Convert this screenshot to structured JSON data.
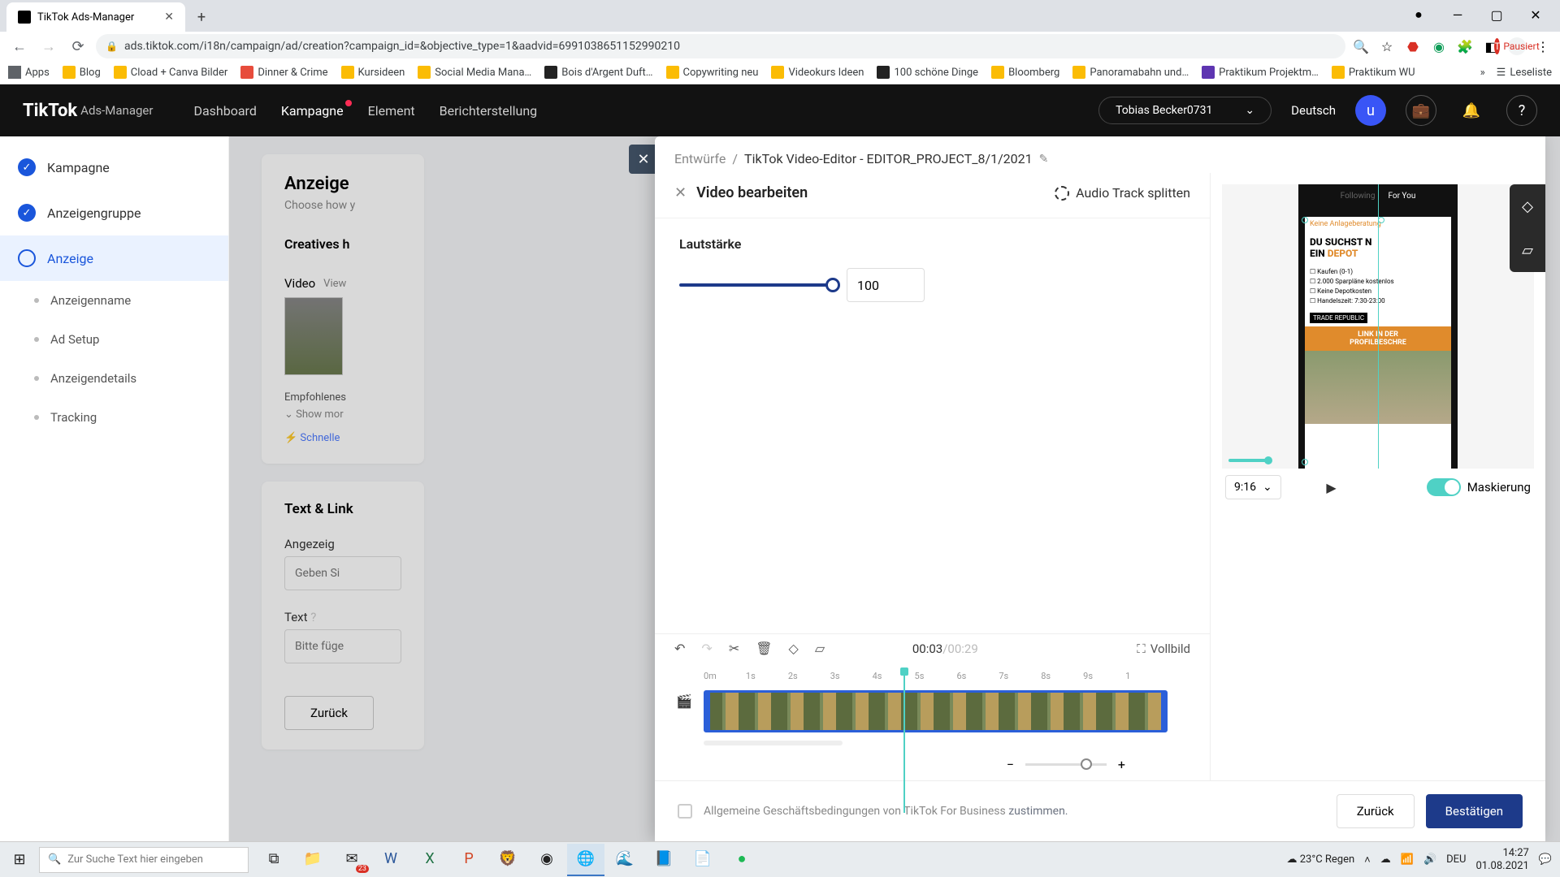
{
  "browser": {
    "tab_title": "TikTok Ads-Manager",
    "url": "ads.tiktok.com/i18n/campaign/ad/creation?campaign_id=&objective_type=1&aadvid=6991038651152990210",
    "profile_status": "Pausiert",
    "bookmarks": [
      "Apps",
      "Blog",
      "Cload + Canva Bilder",
      "Dinner & Crime",
      "Kursideen",
      "Social Media Mana…",
      "Bois d'Argent Duft…",
      "Copywriting neu",
      "Videokurs Ideen",
      "100 schöne Dinge",
      "Bloomberg",
      "Panoramabahn und…",
      "Praktikum Projektm…",
      "Praktikum WU"
    ],
    "reading_list": "Leseliste"
  },
  "header": {
    "brand": "TikTok",
    "brand_sub": "Ads-Manager",
    "nav": [
      "Dashboard",
      "Kampagne",
      "Element",
      "Berichterstellung"
    ],
    "user": "Tobias Becker0731",
    "lang": "Deutsch",
    "avatar": "u"
  },
  "sidebar": {
    "main": [
      "Kampagne",
      "Anzeigengruppe",
      "Anzeige"
    ],
    "subs": [
      "Anzeigenname",
      "Ad Setup",
      "Anzeigendetails",
      "Tracking"
    ]
  },
  "bg": {
    "card1_title": "Anzeige",
    "card1_sub": "Choose how y",
    "creatives_h": "Creatives h",
    "video_label": "Video",
    "view": "View",
    "empf": "Empfohlenes",
    "show_more": "Show mor",
    "schnelle": "Schnelle",
    "text_link": "Text & Link",
    "angezeigt": "Angezeig",
    "geben": "Geben Si",
    "text": "Text",
    "bitte": "Bitte füge",
    "back": "Zurück"
  },
  "editor": {
    "breadcrumb_root": "Entwürfe",
    "breadcrumb_cur": "TikTok Video-Editor - EDITOR_PROJECT_8/1/2021",
    "section_title": "Video bearbeiten",
    "audio_split": "Audio Track splitten",
    "volume_label": "Lautstärke",
    "volume_value": "100",
    "aspect": "9:16",
    "mask_label": "Maskierung",
    "time_current": "00:03",
    "time_total": "/00:29",
    "fullscreen": "Vollbild",
    "ruler": [
      "0m",
      "1s",
      "2s",
      "3s",
      "4s",
      "5s",
      "6s",
      "7s",
      "8s",
      "9s",
      "1"
    ],
    "preview": {
      "headline1": "DU SUCHST N",
      "headline2": "EIN ",
      "headline3": "DEPOT",
      "list": [
        "Kaufen (0-1)",
        "2.000 Sparpläne kostenlos",
        "Keine Depotkosten",
        "Handelszeit: 7:30-23:00"
      ],
      "tag": "TRADE REPUBLIC",
      "link1": "LINK IN DER",
      "link2": "PROFILBESCHRE"
    },
    "agb_text": "Allgemeine Geschäftsbedingungen von TikTok For Business ",
    "agb_link": "zustimmen.",
    "btn_back": "Zurück",
    "btn_confirm": "Bestätigen"
  },
  "taskbar": {
    "search_placeholder": "Zur Suche Text hier eingeben",
    "weather": "23°C  Regen",
    "lang": "DEU",
    "time": "14:27",
    "date": "01.08.2021",
    "mail_badge": "23"
  }
}
